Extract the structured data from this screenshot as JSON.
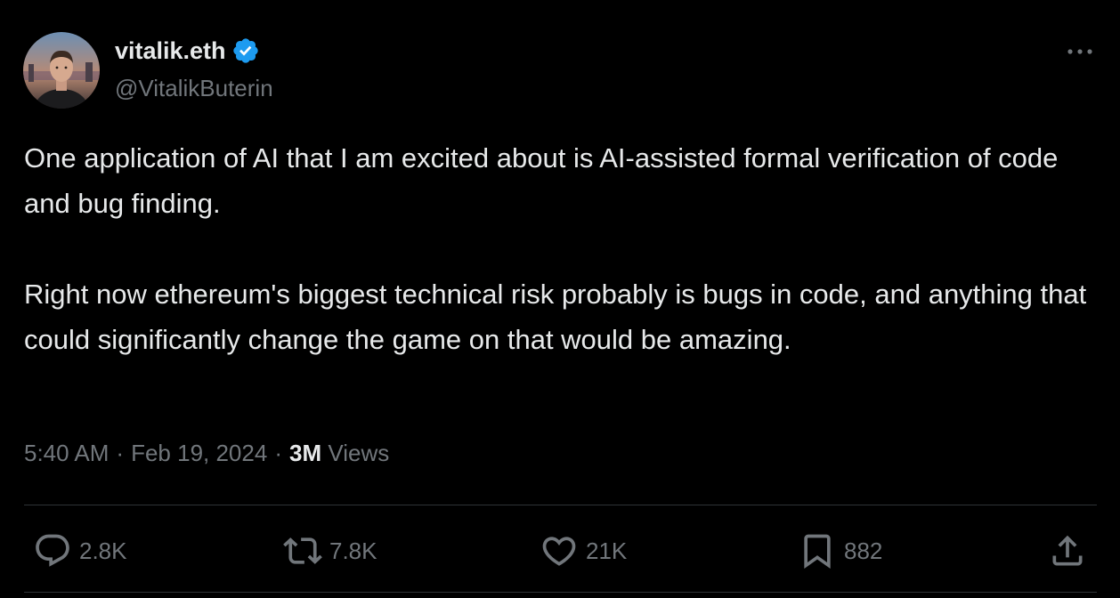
{
  "author": {
    "display_name": "vitalik.eth",
    "handle": "@VitalikButerin",
    "verified_icon": "verified-badge-icon",
    "avatar_icon": "profile-photo"
  },
  "tweet": {
    "paragraphs": [
      "One application of AI that I am excited about is AI-assisted formal verification of code and bug finding.",
      "Right now ethereum's biggest technical risk probably is bugs in code, and anything that could significantly change the game on that would be amazing."
    ],
    "time": "5:40 AM",
    "separator": "·",
    "date": "Feb 19, 2024",
    "views_count": "3M",
    "views_label": "Views"
  },
  "actions": {
    "reply": {
      "count": "2.8K",
      "icon": "reply-icon"
    },
    "repost": {
      "count": "7.8K",
      "icon": "repost-icon"
    },
    "like": {
      "count": "21K",
      "icon": "heart-icon"
    },
    "bookmark": {
      "count": "882",
      "icon": "bookmark-icon"
    },
    "share": {
      "icon": "share-icon"
    }
  },
  "colors": {
    "background": "#000000",
    "primary_text": "#e7e9ea",
    "secondary_text": "#71767b",
    "verified_blue": "#1d9bf0",
    "divider": "#2f3336"
  }
}
